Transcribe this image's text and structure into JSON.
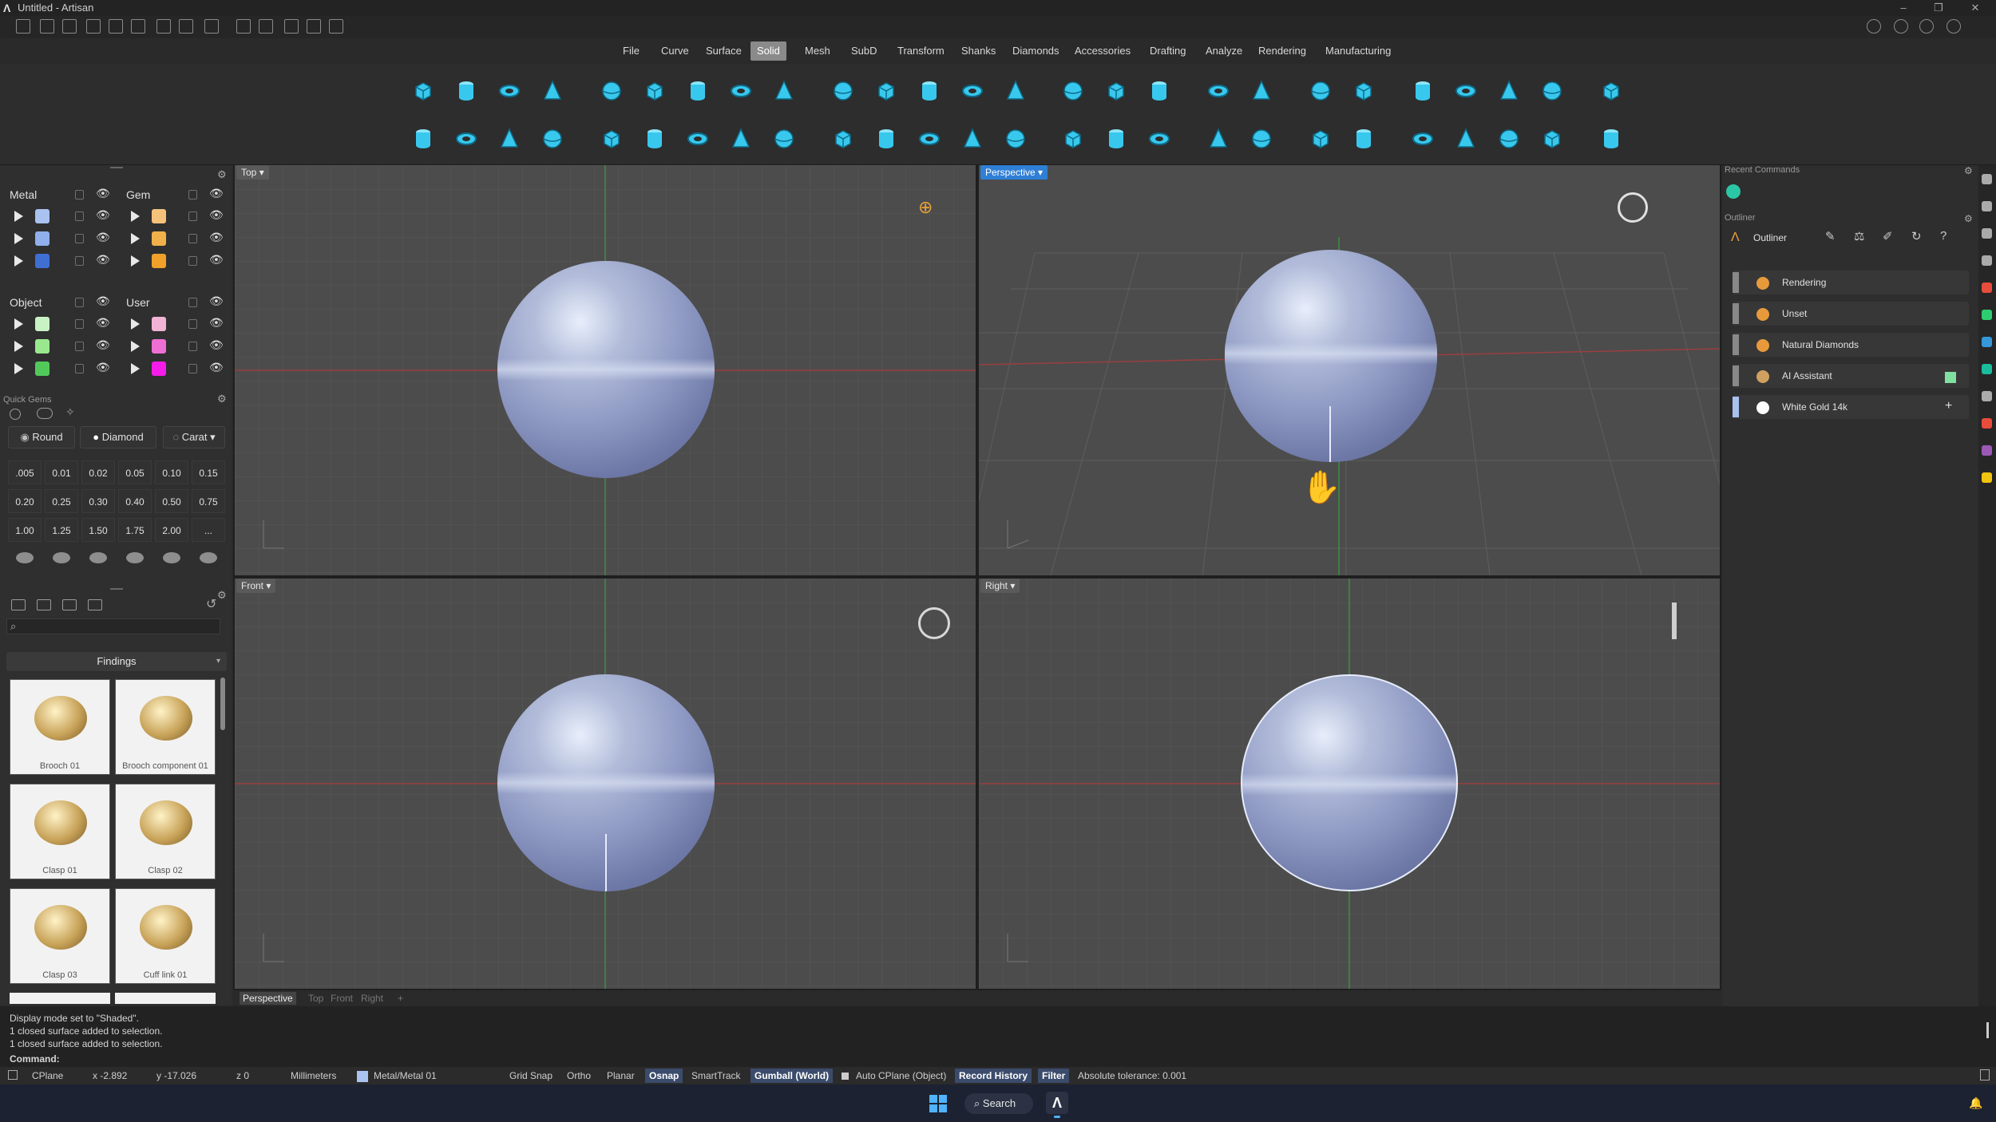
{
  "app": {
    "title": "Untitled - Artisan",
    "window_controls": [
      "–",
      "❐",
      "✕"
    ]
  },
  "menu": [
    {
      "label": "File",
      "active": false
    },
    {
      "label": "Curve",
      "active": false
    },
    {
      "label": "Surface",
      "active": false
    },
    {
      "label": "Solid",
      "active": true
    },
    {
      "label": "Mesh",
      "active": false
    },
    {
      "label": "SubD",
      "active": false
    },
    {
      "label": "Transform",
      "active": false
    },
    {
      "label": "Shanks",
      "active": false
    },
    {
      "label": "Diamonds",
      "active": false
    },
    {
      "label": "Accessories",
      "active": false
    },
    {
      "label": "Drafting",
      "active": false
    },
    {
      "label": "Analyze",
      "active": false
    },
    {
      "label": "Rendering",
      "active": false
    },
    {
      "label": "Manufacturing",
      "active": false
    }
  ],
  "layers": {
    "metal": {
      "label": "Metal",
      "colors": [
        "#a9c2f0",
        "#8fb0ec",
        "#3f6fd3"
      ]
    },
    "gem": {
      "label": "Gem",
      "colors": [
        "#f4c27a",
        "#f2b04a",
        "#f0a12a"
      ]
    },
    "object": {
      "label": "Object",
      "colors": [
        "#c9f2c4",
        "#9ae88e",
        "#51c95a"
      ]
    },
    "user": {
      "label": "User",
      "colors": [
        "#f2b4d6",
        "#ee6fd4",
        "#f51ce9"
      ]
    }
  },
  "quick_gems": {
    "title": "Quick Gems",
    "buttons": [
      "Round",
      "Diamond",
      "Carat"
    ],
    "carats": [
      ".005",
      "0.01",
      "0.02",
      "0.05",
      "0.10",
      "0.15",
      "0.20",
      "0.25",
      "0.30",
      "0.40",
      "0.50",
      "0.75",
      "1.00",
      "1.25",
      "1.50",
      "1.75",
      "2.00",
      "..."
    ]
  },
  "library": {
    "search_placeholder": "",
    "category": "Findings",
    "items": [
      "Brooch 01",
      "Brooch component 01",
      "Clasp 01",
      "Clasp 02",
      "Clasp 03",
      "Cuff link 01"
    ]
  },
  "viewports": {
    "top": "Top",
    "perspective": "Perspective",
    "front": "Front",
    "right": "Right"
  },
  "view_tabs": [
    "Perspective",
    "Top",
    "Front",
    "Right",
    "+"
  ],
  "right_panel": {
    "recent_commands": "Recent Commands",
    "outliner_title": "Outliner",
    "outliner_header": "Outliner",
    "items": [
      "Rendering",
      "Unset",
      "Natural Diamonds",
      "AI Assistant",
      "White Gold 14k"
    ],
    "item_colors": [
      "#e79a3b",
      "#e79a3b",
      "#e79a3b",
      "#d0a060",
      "#ffffff"
    ],
    "ai_swatch": "#7fe0a0"
  },
  "command": {
    "history": [
      "Display mode set to \"Shaded\".",
      "1 closed surface added to selection.",
      "1 closed surface added to selection."
    ],
    "prompt": "Command:"
  },
  "status": {
    "cplane": "CPlane",
    "x": "x -2.892",
    "y": "y -17.026",
    "z": "z 0",
    "units": "Millimeters",
    "layer": "Metal/Metal 01",
    "grid_snap": "Grid Snap",
    "ortho": "Ortho",
    "planar": "Planar",
    "osnap": "Osnap",
    "smarttrack": "SmartTrack",
    "gumball": "Gumball (World)",
    "auto_cplane": "Auto CPlane (Object)",
    "record_history": "Record History",
    "filter": "Filter",
    "tolerance": "Absolute tolerance: 0.001"
  },
  "taskbar": {
    "search": "Search"
  },
  "colors": {
    "accent": "#2f7fd6",
    "tool": "#38c8ee",
    "sphere": "#8f9ac4"
  }
}
